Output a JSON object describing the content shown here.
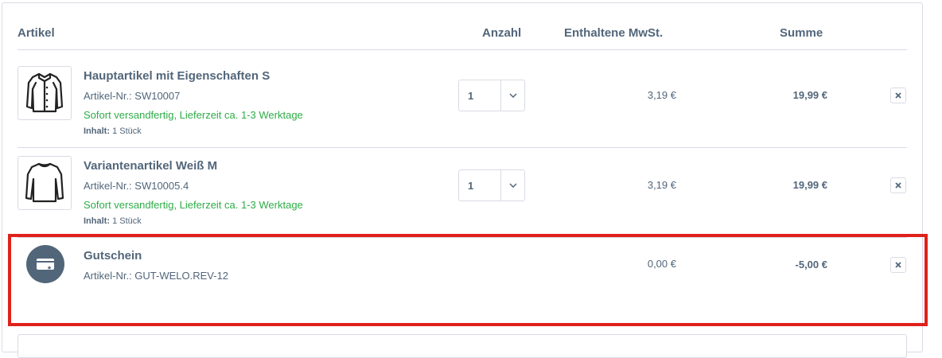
{
  "table_header": {
    "article": "Artikel",
    "quantity": "Anzahl",
    "tax": "Enthaltene MwSt.",
    "total": "Summe"
  },
  "items": [
    {
      "name": "Hauptartikel mit Eigenschaften S",
      "sku": "Artikel-Nr.: SW10007",
      "availability": "Sofort versandfertig, Lieferzeit ca. 1-3 Werktage",
      "content_label": "Inhalt:",
      "content_value": "1 Stück",
      "quantity": "1",
      "tax": "3,19 €",
      "total": "19,99 €",
      "image_icon": "jacket-icon"
    },
    {
      "name": "Variantenartikel Weiß M",
      "sku": "Artikel-Nr.: SW10005.4",
      "availability": "Sofort versandfertig, Lieferzeit ca. 1-3 Werktage",
      "content_label": "Inhalt:",
      "content_value": "1 Stück",
      "quantity": "1",
      "tax": "3,19 €",
      "total": "19,99 €",
      "image_icon": "longsleeve-shirt-icon"
    }
  ],
  "voucher": {
    "name": "Gutschein",
    "sku": "Artikel-Nr.: GUT-WELO.REV-12",
    "tax": "0,00 €",
    "total": "-5,00 €",
    "icon": "voucher-card-icon"
  },
  "colors": {
    "text": "#52667a",
    "availability": "#2ead48",
    "highlight": "#e0211b",
    "border": "#dadae5"
  }
}
